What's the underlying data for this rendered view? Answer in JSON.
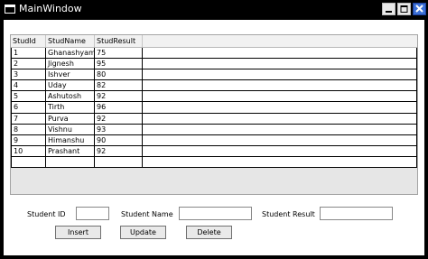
{
  "window": {
    "title": "MainWindow"
  },
  "grid": {
    "columns": [
      "StudId",
      "StudName",
      "StudResult"
    ],
    "rows": [
      [
        "1",
        "Ghanashyam",
        "75"
      ],
      [
        "2",
        "Jignesh",
        "95"
      ],
      [
        "3",
        "Ishver",
        "80"
      ],
      [
        "4",
        "Uday",
        "82"
      ],
      [
        "5",
        "Ashutosh",
        "92"
      ],
      [
        "6",
        "Tirth",
        "96"
      ],
      [
        "7",
        "Purva",
        "92"
      ],
      [
        "8",
        "Vishnu",
        "93"
      ],
      [
        "9",
        "Himanshu",
        "90"
      ],
      [
        "10",
        "Prashant",
        "92"
      ],
      [
        "",
        "",
        ""
      ]
    ]
  },
  "form": {
    "student_id_label": "Student ID",
    "student_id_value": "",
    "student_name_label": "Student Name",
    "student_name_value": "",
    "student_result_label": "Student Result",
    "student_result_value": ""
  },
  "buttons": {
    "insert": "Insert",
    "update": "Update",
    "delete": "Delete"
  }
}
